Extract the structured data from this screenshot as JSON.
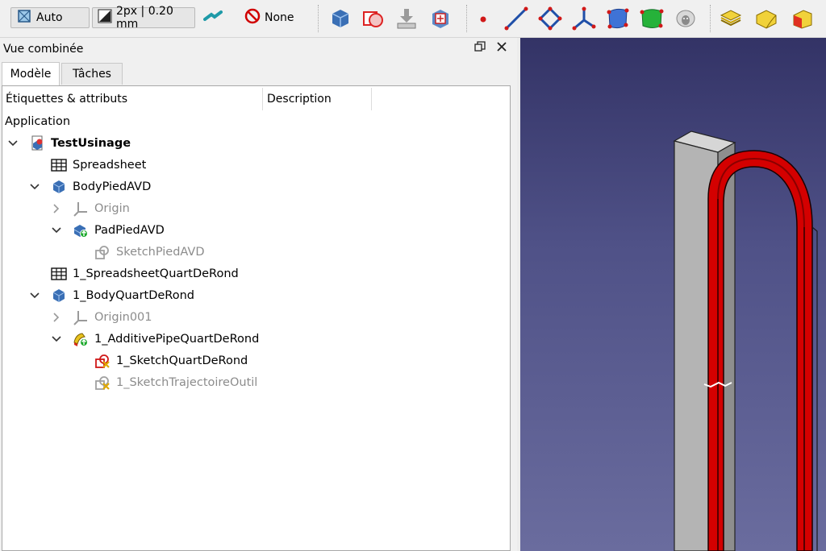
{
  "toolbar": {
    "draw_style_label": "Auto",
    "line_width_label": "2px | 0.20 mm",
    "selection_filter_label": "None"
  },
  "panel": {
    "title": "Vue combinée",
    "tabs": [
      {
        "label": "Modèle"
      },
      {
        "label": "Tâches"
      }
    ],
    "columns": [
      "Étiquettes & attributs",
      "Description"
    ],
    "root_label": "Application",
    "tree": [
      {
        "label": "TestUsinage"
      },
      {
        "label": "Spreadsheet"
      },
      {
        "label": "BodyPiedAVD"
      },
      {
        "label": "Origin"
      },
      {
        "label": "PadPiedAVD"
      },
      {
        "label": "SketchPiedAVD"
      },
      {
        "label": "1_SpreadsheetQuartDeRond"
      },
      {
        "label": "1_BodyQuartDeRond"
      },
      {
        "label": "Origin001"
      },
      {
        "label": "1_AdditivePipeQuartDeRond"
      },
      {
        "label": "1_SketchQuartDeRond"
      },
      {
        "label": "1_SketchTrajectoireOutil"
      }
    ]
  },
  "colors": {
    "viewport_top": "#333366",
    "viewport_bottom": "#6a6c9e",
    "pipe_red": "#d40000",
    "box_grey": "#b4b4b4"
  },
  "icons": [
    "draw-style-icon",
    "line-width-icon",
    "measure-icon",
    "no-entry-icon",
    "part-box-icon",
    "boolean-icon",
    "import-icon",
    "export-icon",
    "point-icon",
    "line-icon",
    "polygon-icon",
    "axis-icon",
    "blue-face-icon",
    "green-face-icon",
    "sheep-icon",
    "layers-icon",
    "extrude-icon",
    "red-box-icon"
  ]
}
